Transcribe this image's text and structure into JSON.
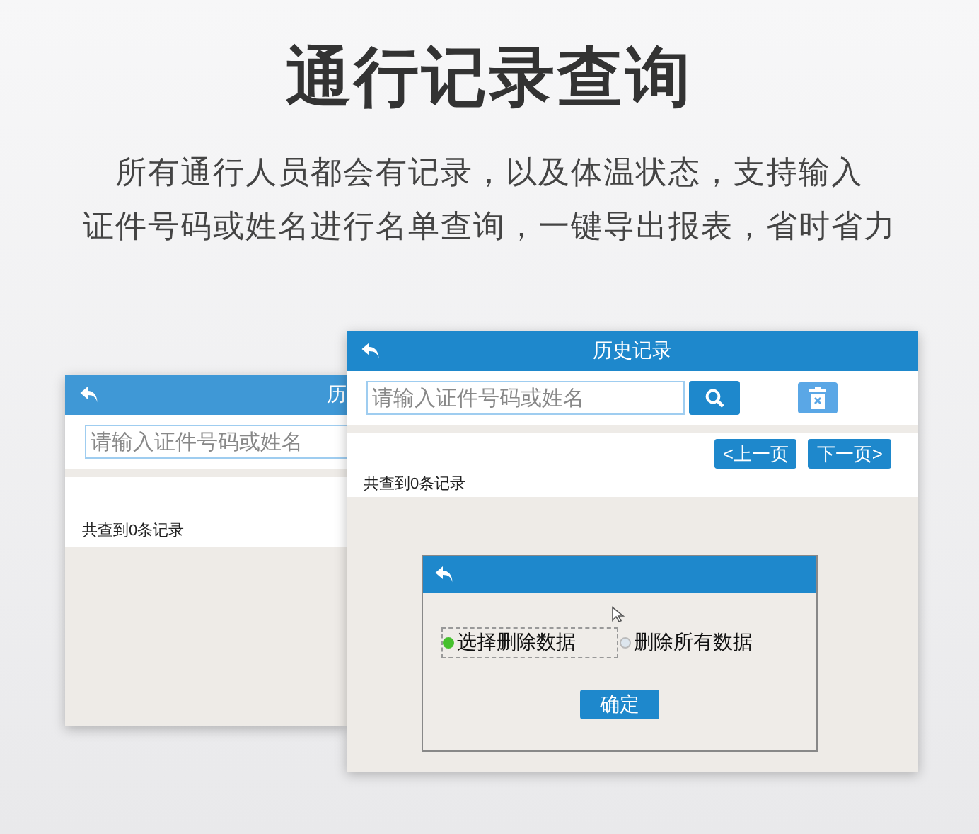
{
  "headline": "通行记录查询",
  "description": [
    "所有通行人员都会有记录，以及体温状态，支持输入",
    "证件号码或姓名进行名单查询，一键导出报表，省时省力"
  ],
  "back_window": {
    "title": "历",
    "search": {
      "placeholder": "请输入证件号码或姓名"
    },
    "result_count": "共查到0条记录"
  },
  "front_window": {
    "title": "历史记录",
    "search": {
      "placeholder": "请输入证件号码或姓名"
    },
    "pager": [
      "<上一页",
      "下一页>"
    ],
    "result_count": "共查到0条记录",
    "dialog": {
      "options": [
        {
          "label": "选择删除数据",
          "selected": true
        },
        {
          "label": "删除所有数据",
          "selected": false
        }
      ],
      "confirm": "确定"
    }
  }
}
